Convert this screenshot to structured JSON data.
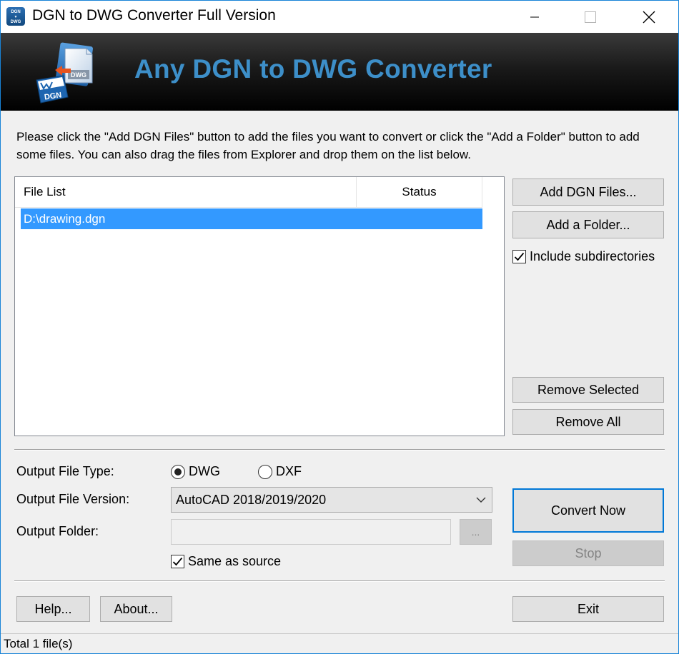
{
  "window": {
    "title": "DGN to DWG Converter Full Version",
    "app_icon_text_top": "DGN",
    "app_icon_text_bottom": "DWG"
  },
  "banner": {
    "title": "Any DGN to DWG Converter",
    "logo_labels": [
      "DGN",
      "DWG"
    ]
  },
  "instructions": "Please click the \"Add DGN Files\" button to add the files you want to convert or click the \"Add a Folder\" button to add some files. You can also drag the files from Explorer and drop them on the list below.",
  "file_list": {
    "columns": [
      "File List",
      "Status"
    ],
    "rows": [
      {
        "file": "D:\\drawing.dgn",
        "status": "",
        "selected": true
      }
    ]
  },
  "side_buttons": {
    "add_files": "Add DGN Files...",
    "add_folder": "Add a Folder...",
    "include_subdirs": "Include subdirectories",
    "include_subdirs_checked": true,
    "remove_selected": "Remove Selected",
    "remove_all": "Remove All"
  },
  "output": {
    "type_label": "Output File Type:",
    "type_options": [
      "DWG",
      "DXF"
    ],
    "type_selected": "DWG",
    "version_label": "Output File Version:",
    "version_value": "AutoCAD 2018/2019/2020",
    "folder_label": "Output Folder:",
    "folder_value": "",
    "browse_label": "...",
    "same_as_source": "Same as source",
    "same_as_source_checked": true
  },
  "actions": {
    "convert": "Convert Now",
    "stop": "Stop",
    "help": "Help...",
    "about": "About...",
    "exit": "Exit"
  },
  "status_bar": "Total 1 file(s)",
  "colors": {
    "accent": "#0078d7",
    "selection": "#3399ff",
    "banner_text": "#3d8fc9"
  }
}
